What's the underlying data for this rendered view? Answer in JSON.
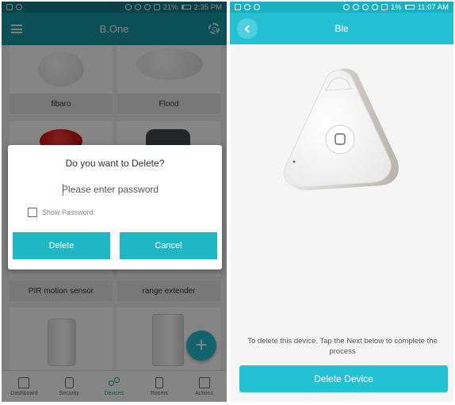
{
  "left": {
    "status": {
      "battery": "21%",
      "time": "2:35 PM",
      "battery_level": 0.21
    },
    "app_title": "B.One",
    "tiles": [
      {
        "label": "fibaro"
      },
      {
        "label": "Flood"
      },
      {
        "label": "PIR motion sensor"
      },
      {
        "label": "range extender"
      }
    ],
    "nav": [
      {
        "label": "Dashboard",
        "icon": "house-icon"
      },
      {
        "label": "Security",
        "icon": "lock-icon"
      },
      {
        "label": "Devices",
        "icon": "share-icon"
      },
      {
        "label": "Rooms",
        "icon": "door-icon"
      },
      {
        "label": "Actions",
        "icon": "calendar-icon"
      }
    ],
    "active_nav": "Devices",
    "fab_glyph": "+",
    "dialog": {
      "title": "Do you want to Delete?",
      "password_placeholder": "Please enter password",
      "show_password_label": "Show Password",
      "delete_label": "Delete",
      "cancel_label": "Cancel"
    },
    "colors": {
      "accent": "#179aa8",
      "button": "#1fb6c6"
    }
  },
  "right": {
    "status": {
      "battery": "1%",
      "time": "11:07 AM",
      "battery_level": 0.01
    },
    "app_title": "Ble",
    "info_text": "To delete this device. Tap the Next below to complete the process",
    "button_label": "Delete Device",
    "colors": {
      "accent": "#23c1d3"
    }
  }
}
